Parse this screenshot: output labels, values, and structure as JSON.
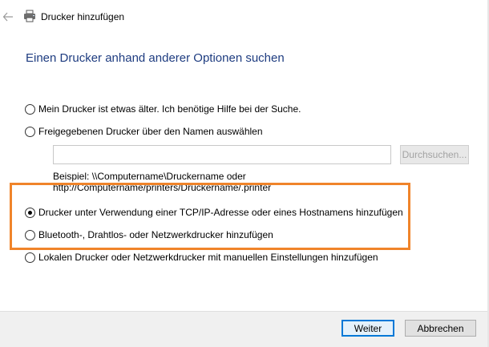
{
  "window": {
    "title": "Drucker hinzufügen",
    "back_icon": "arrow-left-icon",
    "app_icon": "printer-icon"
  },
  "main": {
    "heading": "Einen Drucker anhand anderer Optionen suchen",
    "options": [
      {
        "label": "Mein Drucker ist etwas älter. Ich benötige Hilfe bei der Suche.",
        "checked": false
      },
      {
        "label": "Freigegebenen Drucker über den Namen auswählen",
        "checked": false
      },
      {
        "label": "Drucker unter Verwendung einer TCP/IP-Adresse oder eines Hostnamens hinzufügen",
        "checked": true
      },
      {
        "label": "Bluetooth-, Drahtlos- oder Netzwerkdrucker hinzufügen",
        "checked": false
      },
      {
        "label": "Lokalen Drucker oder Netzwerkdrucker mit manuellen Einstellungen hinzufügen",
        "checked": false
      }
    ],
    "shared_printer": {
      "value": "",
      "browse_label": "Durchsuchen...",
      "example_line1": "Beispiel: \\\\Computername\\Druckername oder",
      "example_line2": "http://Computername/printers/Druckername/.printer"
    }
  },
  "footer": {
    "next_label": "Weiter",
    "cancel_label": "Abbrechen"
  },
  "colors": {
    "heading": "#1e3c80",
    "highlight": "#f0842a",
    "primary_border": "#0078d7",
    "footer_bg": "#f0f0f0"
  }
}
